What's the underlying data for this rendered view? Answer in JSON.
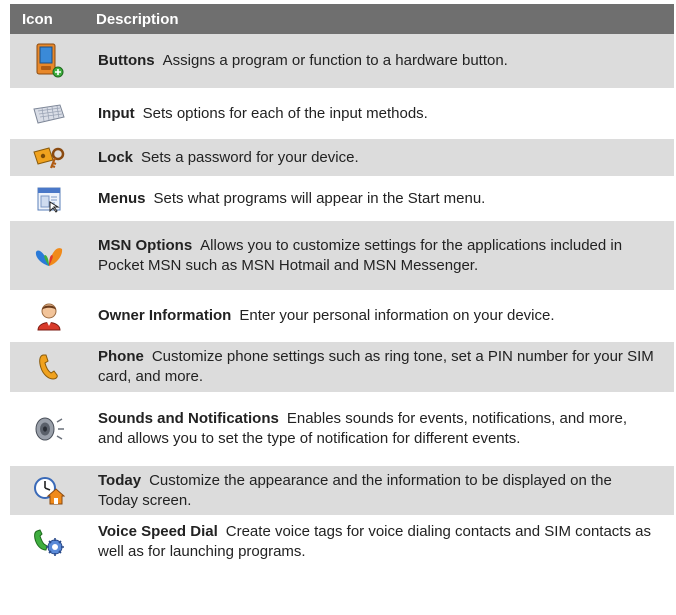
{
  "header": {
    "icon": "Icon",
    "description": "Description"
  },
  "rows": [
    {
      "icon": "buttons-icon",
      "name": "Buttons",
      "text": "Assigns a program or function to a hardware button."
    },
    {
      "icon": "keyboard-icon",
      "name": "Input",
      "text": "Sets options for each of the input methods."
    },
    {
      "icon": "lock-key-icon",
      "name": "Lock",
      "text": "Sets a password for your device."
    },
    {
      "icon": "menus-window-icon",
      "name": "Menus",
      "text": "Sets what programs will appear in the Start menu."
    },
    {
      "icon": "msn-butterfly-icon",
      "name": "MSN Options",
      "text": "Allows you to customize settings for the applications included in Pocket MSN such as MSN Hotmail and MSN Messenger."
    },
    {
      "icon": "owner-person-icon",
      "name": "Owner Information",
      "text": "Enter your personal information on your device."
    },
    {
      "icon": "phone-handset-icon",
      "name": "Phone",
      "text": "Customize phone settings such as ring tone, set a PIN number for your SIM card, and more."
    },
    {
      "icon": "speaker-icon",
      "name": "Sounds and Notifications",
      "text": "Enables sounds for events, notifications, and more, and allows you to set the type of notification for different events."
    },
    {
      "icon": "today-clock-home-icon",
      "name": "Today",
      "text": "Customize the appearance and the information to be displayed on the Today screen."
    },
    {
      "icon": "voice-dial-phone-gear-icon",
      "name": "Voice Speed Dial",
      "text": "Create voice tags for voice dialing contacts and SIM contacts as well as for launching programs."
    }
  ]
}
